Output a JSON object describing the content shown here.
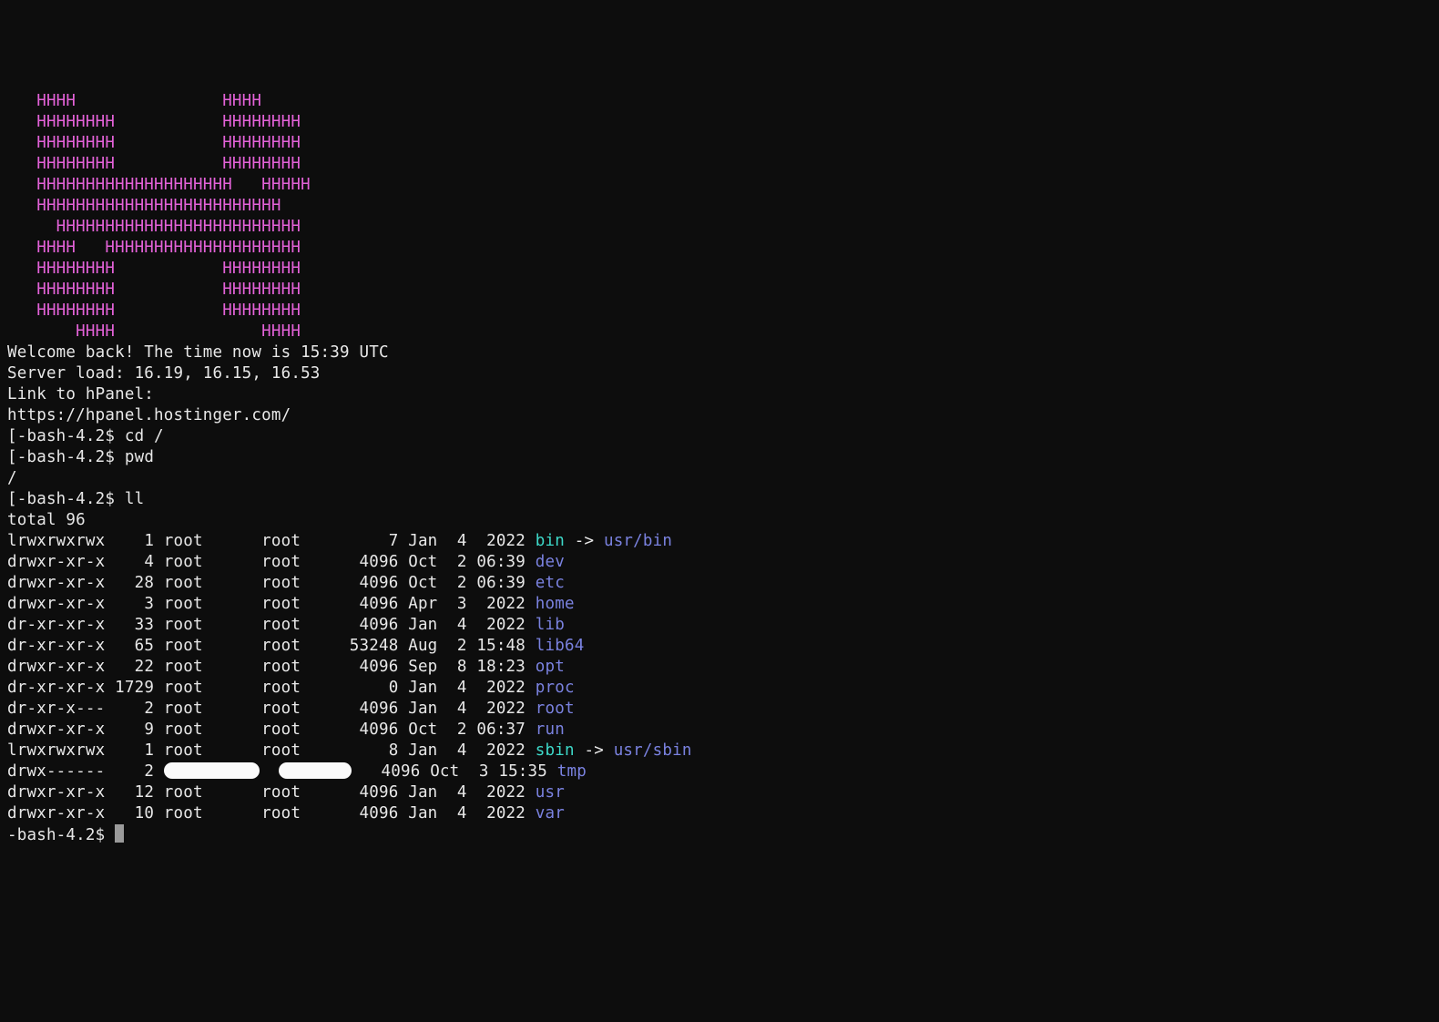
{
  "ascii_art": [
    "   HHHH               HHHH",
    "   HHHHHHHH           HHHHHHHH",
    "   HHHHHHHH           HHHHHHHH",
    "   HHHHHHHH           HHHHHHHH",
    "   HHHHHHHHHHHHHHHHHHHH   HHHHH",
    "   HHHHHHHHHHHHHHHHHHHHHHHHH",
    "     HHHHHHHHHHHHHHHHHHHHHHHHH",
    "   HHHH   HHHHHHHHHHHHHHHHHHHH",
    "   HHHHHHHH           HHHHHHHH",
    "   HHHHHHHH           HHHHHHHH",
    "   HHHHHHHH           HHHHHHHH",
    "       HHHH               HHHH"
  ],
  "motd": {
    "welcome": "Welcome back! The time now is 15:39 UTC",
    "load": "Server load: 16.19, 16.15, 16.53",
    "link_label": "Link to hPanel:",
    "link_url": "https://hpanel.hostinger.com/"
  },
  "prompt1": "[-bash-4.2$ ",
  "prompt2": "-bash-4.2$ ",
  "cmd1": "cd /",
  "cmd2": "pwd",
  "pwd_out": "/",
  "cmd3": "ll",
  "ll_total": "total 96",
  "ll": [
    {
      "perm": "lrwxrwxrwx",
      "n": "   1",
      "u": "root",
      "g": "root",
      "sz": "    7",
      "d": "Jan  4  2022",
      "name": "bin",
      "link": "usr/bin",
      "nc": "cyan"
    },
    {
      "perm": "drwxr-xr-x",
      "n": "   4",
      "u": "root",
      "g": "root",
      "sz": " 4096",
      "d": "Oct  2 06:39",
      "name": "dev",
      "nc": "blue"
    },
    {
      "perm": "drwxr-xr-x",
      "n": "  28",
      "u": "root",
      "g": "root",
      "sz": " 4096",
      "d": "Oct  2 06:39",
      "name": "etc",
      "nc": "blue"
    },
    {
      "perm": "drwxr-xr-x",
      "n": "   3",
      "u": "root",
      "g": "root",
      "sz": " 4096",
      "d": "Apr  3  2022",
      "name": "home",
      "nc": "blue"
    },
    {
      "perm": "dr-xr-xr-x",
      "n": "  33",
      "u": "root",
      "g": "root",
      "sz": " 4096",
      "d": "Jan  4  2022",
      "name": "lib",
      "nc": "blue"
    },
    {
      "perm": "dr-xr-xr-x",
      "n": "  65",
      "u": "root",
      "g": "root",
      "sz": "53248",
      "d": "Aug  2 15:48",
      "name": "lib64",
      "nc": "blue"
    },
    {
      "perm": "drwxr-xr-x",
      "n": "  22",
      "u": "root",
      "g": "root",
      "sz": " 4096",
      "d": "Sep  8 18:23",
      "name": "opt",
      "nc": "blue"
    },
    {
      "perm": "dr-xr-xr-x",
      "n": "1729",
      "u": "root",
      "g": "root",
      "sz": "    0",
      "d": "Jan  4  2022",
      "name": "proc",
      "nc": "blue"
    },
    {
      "perm": "dr-xr-x---",
      "n": "   2",
      "u": "root",
      "g": "root",
      "sz": " 4096",
      "d": "Jan  4  2022",
      "name": "root",
      "nc": "blue"
    },
    {
      "perm": "drwxr-xr-x",
      "n": "   9",
      "u": "root",
      "g": "root",
      "sz": " 4096",
      "d": "Oct  2 06:37",
      "name": "run",
      "nc": "blue"
    },
    {
      "perm": "lrwxrwxrwx",
      "n": "   1",
      "u": "root",
      "g": "root",
      "sz": "    8",
      "d": "Jan  4  2022",
      "name": "sbin",
      "link": "usr/sbin",
      "nc": "cyan"
    },
    {
      "perm": "drwx------",
      "n": "   2",
      "u": "",
      "g": "",
      "sz": " 4096",
      "d": "Oct  3 15:35",
      "name": "tmp",
      "nc": "blue",
      "redact": true
    },
    {
      "perm": "drwxr-xr-x",
      "n": "  12",
      "u": "root",
      "g": "root",
      "sz": " 4096",
      "d": "Jan  4  2022",
      "name": "usr",
      "nc": "blue"
    },
    {
      "perm": "drwxr-xr-x",
      "n": "  10",
      "u": "root",
      "g": "root",
      "sz": " 4096",
      "d": "Jan  4  2022",
      "name": "var",
      "nc": "blue"
    }
  ]
}
